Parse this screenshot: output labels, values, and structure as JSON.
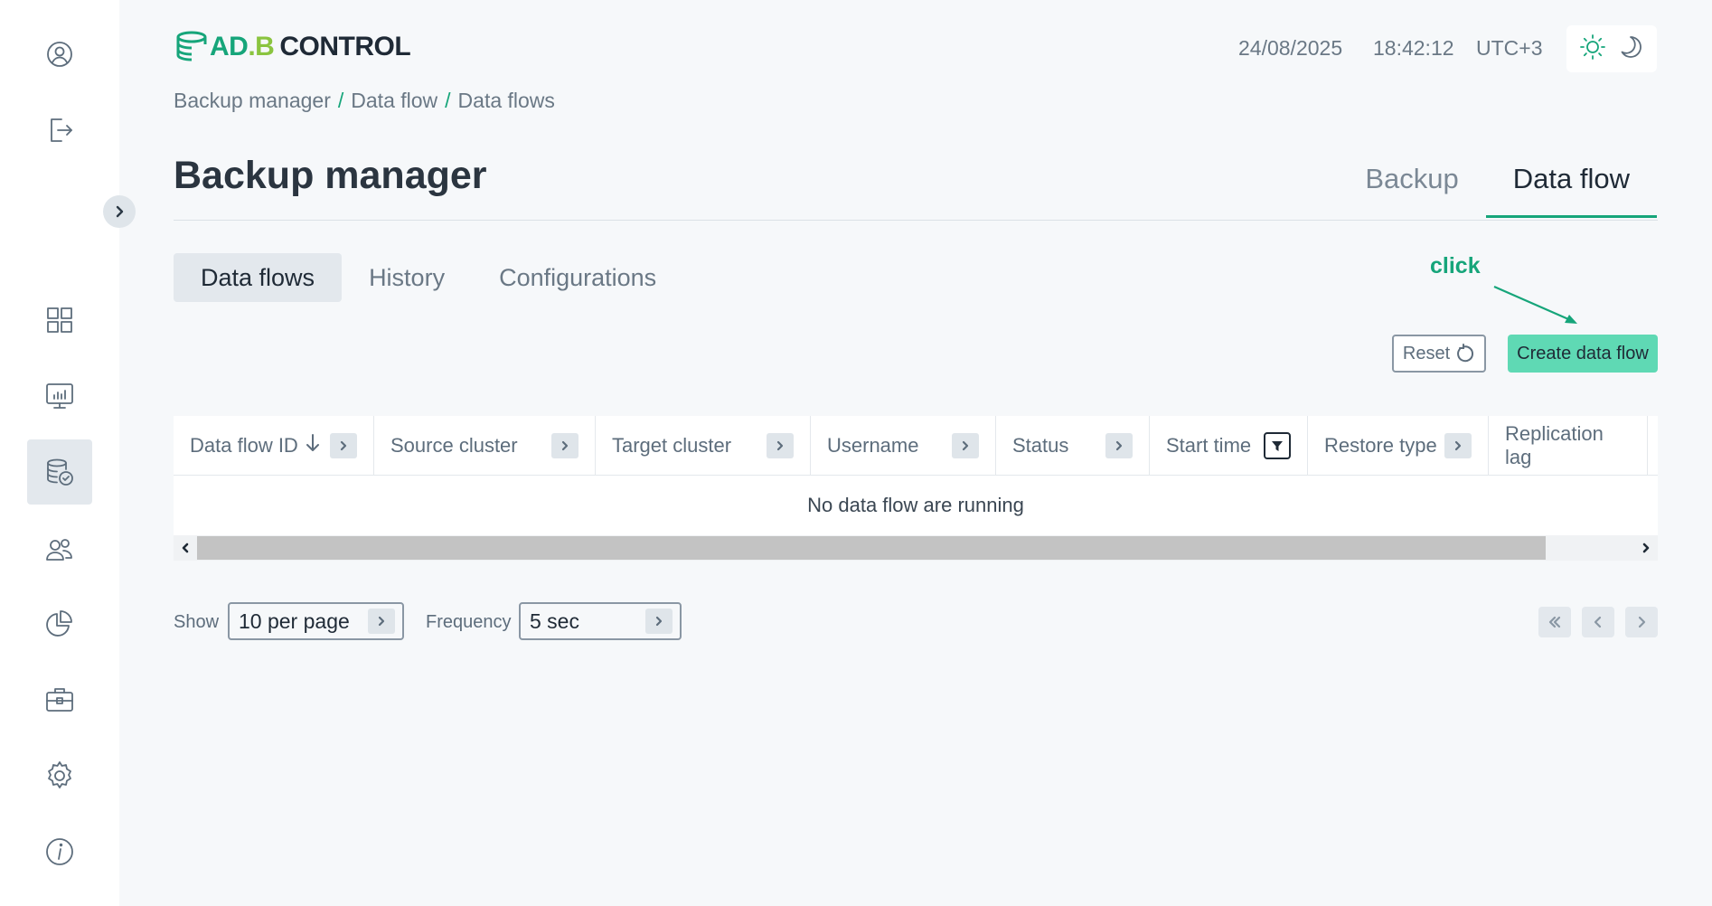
{
  "header": {
    "logo": {
      "ad": "AD",
      "dot": ".B",
      "control": "CONTROL"
    },
    "date": "24/08/2025",
    "time": "18:42:12",
    "timezone": "UTC+3"
  },
  "sidebar": {
    "items": [
      {
        "icon": "user-circle-icon"
      },
      {
        "icon": "logout-icon"
      },
      {
        "icon": "dashboard-grid-icon"
      },
      {
        "icon": "monitoring-chart-icon"
      },
      {
        "icon": "database-check-icon",
        "active": true
      },
      {
        "icon": "users-icon"
      },
      {
        "icon": "pie-chart-icon"
      },
      {
        "icon": "briefcase-icon"
      },
      {
        "icon": "gear-icon"
      },
      {
        "icon": "info-icon"
      }
    ]
  },
  "breadcrumb": [
    "Backup manager",
    "Data flow",
    "Data flows"
  ],
  "breadcrumb_sep": "/",
  "page": {
    "title": "Backup manager"
  },
  "top_tabs": [
    "Backup",
    "Data flow"
  ],
  "sub_tabs": [
    "Data flows",
    "History",
    "Configurations"
  ],
  "annotation": {
    "text": "click",
    "color": "#16a57a"
  },
  "actions": {
    "reset": "Reset",
    "create": "Create data flow"
  },
  "table": {
    "columns": [
      "Data flow ID",
      "Source cluster",
      "Target cluster",
      "Username",
      "Status",
      "Start time",
      "Restore type",
      "Replication lag"
    ],
    "empty_text": "No data flow are running"
  },
  "footer": {
    "show_label": "Show",
    "show_value": "10 per page",
    "frequency_label": "Frequency",
    "frequency_value": "5 sec"
  },
  "colors": {
    "accent": "#16a57a",
    "create_button": "#5fd9b4",
    "logo_dot": "#8ac43f"
  }
}
